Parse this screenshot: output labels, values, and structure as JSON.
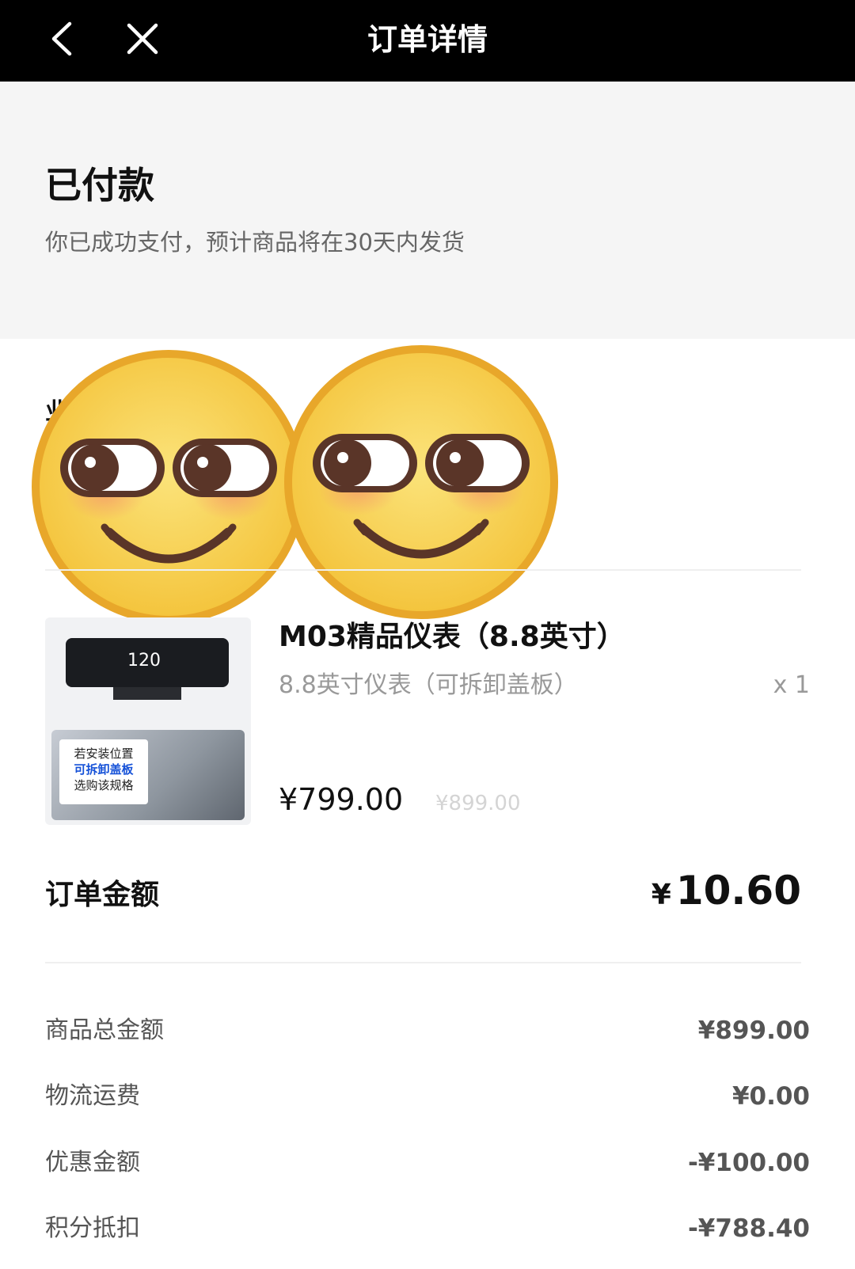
{
  "nav": {
    "back_icon": "chevron-left-icon",
    "close_icon": "close-icon",
    "title": "订单详情"
  },
  "status": {
    "heading": "已付款",
    "description": "你已成功支付，预计商品将在30天内发货"
  },
  "section": {
    "label_partial": "业"
  },
  "stickers": [
    "smirking-face-emoji",
    "smirking-face-emoji"
  ],
  "product": {
    "name": "M03精品仪表（8.8英寸）",
    "spec": "8.8英寸仪表（可拆卸盖板）",
    "quantity": "x 1",
    "price": "¥799.00",
    "original_price": "¥899.00",
    "image": {
      "speed_readout": "120",
      "badge_line1": "若安装位置",
      "badge_line2": "可拆卸盖板",
      "badge_line3": "选购该规格"
    }
  },
  "order_total": {
    "label": "订单金额",
    "currency": "¥",
    "amount": "10.60"
  },
  "breakdown": [
    {
      "label": "商品总金额",
      "value": "¥899.00"
    },
    {
      "label": "物流运费",
      "value": "¥0.00"
    },
    {
      "label": "优惠金额",
      "value": "-¥100.00"
    },
    {
      "label": "积分抵扣",
      "value": "-¥788.40"
    }
  ],
  "colors": {
    "nav_bg": "#000000",
    "status_bg": "#f5f5f5",
    "emoji_face": "#f7d24a",
    "emoji_rim": "#e8a72a",
    "badge_highlight": "#1652d8"
  }
}
